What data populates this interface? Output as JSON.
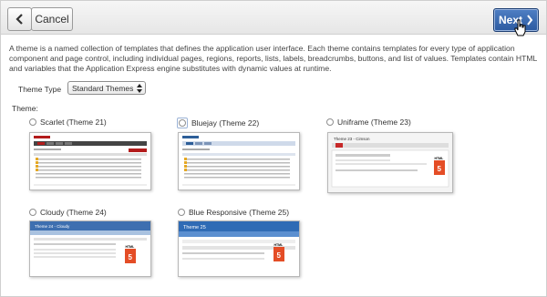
{
  "toolbar": {
    "cancel_label": "Cancel",
    "next_label": "Next"
  },
  "description": "A theme is a named collection of templates that defines the application user interface. Each theme contains templates for every type of application component and page control, including individual pages, regions, reports, lists, labels, breadcrumbs, buttons, and list of values. Templates contain HTML and variables that the Application Express engine substitutes with dynamic values at runtime.",
  "theme_type": {
    "label": "Theme Type",
    "selected": "Standard Themes"
  },
  "theme_label": "Theme:",
  "themes": [
    {
      "label": "Scarlet (Theme 21)"
    },
    {
      "label": "Bluejay (Theme 22)",
      "focused": true
    },
    {
      "label": "Uniframe (Theme 23)"
    },
    {
      "label": "Cloudy (Theme 24)"
    },
    {
      "label": "Blue Responsive (Theme 25)"
    }
  ],
  "previews": {
    "uniframe_title": "Theme 23 - Cimson",
    "cloudy_title": "Theme 24 - Cloudy",
    "blue_responsive_title": "Theme 25",
    "html_badge": "HTML",
    "html_version": "5"
  },
  "icons": {
    "back": "chevron-left-icon",
    "next": "chevron-right-icon",
    "select": "updown-arrows-icon",
    "cursor": "hand-pointer-icon"
  },
  "colors": {
    "next_button": "#2c5aa0",
    "scarlet_accent": "#b31b1b",
    "bluejay_accent": "#2d5e98",
    "html5_orange": "#e44d26"
  }
}
